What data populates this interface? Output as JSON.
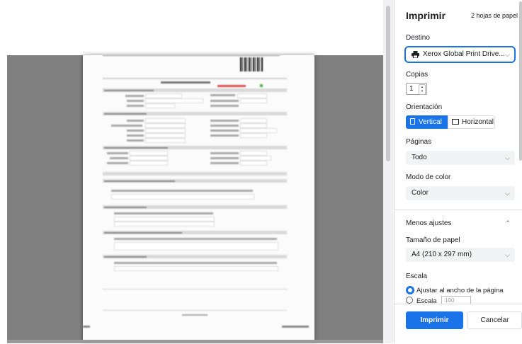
{
  "panel": {
    "title": "Imprimir",
    "sheet_count": "2 hojas de papel",
    "destination": {
      "label": "Destino",
      "value": "Xerox Global Print Drive..."
    },
    "copies": {
      "label": "Copias",
      "value": "1"
    },
    "orientation": {
      "label": "Orientación",
      "vertical": "Vertical",
      "horizontal": "Horizontal",
      "selected": "Vertical"
    },
    "pages": {
      "label": "Páginas",
      "value": "Todo"
    },
    "color_mode": {
      "label": "Modo de color",
      "value": "Color"
    },
    "less_settings": "Menos ajustes",
    "paper_size": {
      "label": "Tamaño de papel",
      "value": "A4 (210 x 297 mm)"
    },
    "scale": {
      "label": "Escala",
      "fit_option": "Ajustar al ancho de la página",
      "custom_option": "Escala",
      "custom_value": "100"
    },
    "print_button": "Imprimir",
    "cancel_button": "Cancelar"
  },
  "colors": {
    "accent": "#1a73e8",
    "preview_bg": "#808080",
    "field_bg": "#f1f3f4"
  },
  "icons": {
    "printer": "printer-icon",
    "chevron": "chevron-down-icon"
  }
}
